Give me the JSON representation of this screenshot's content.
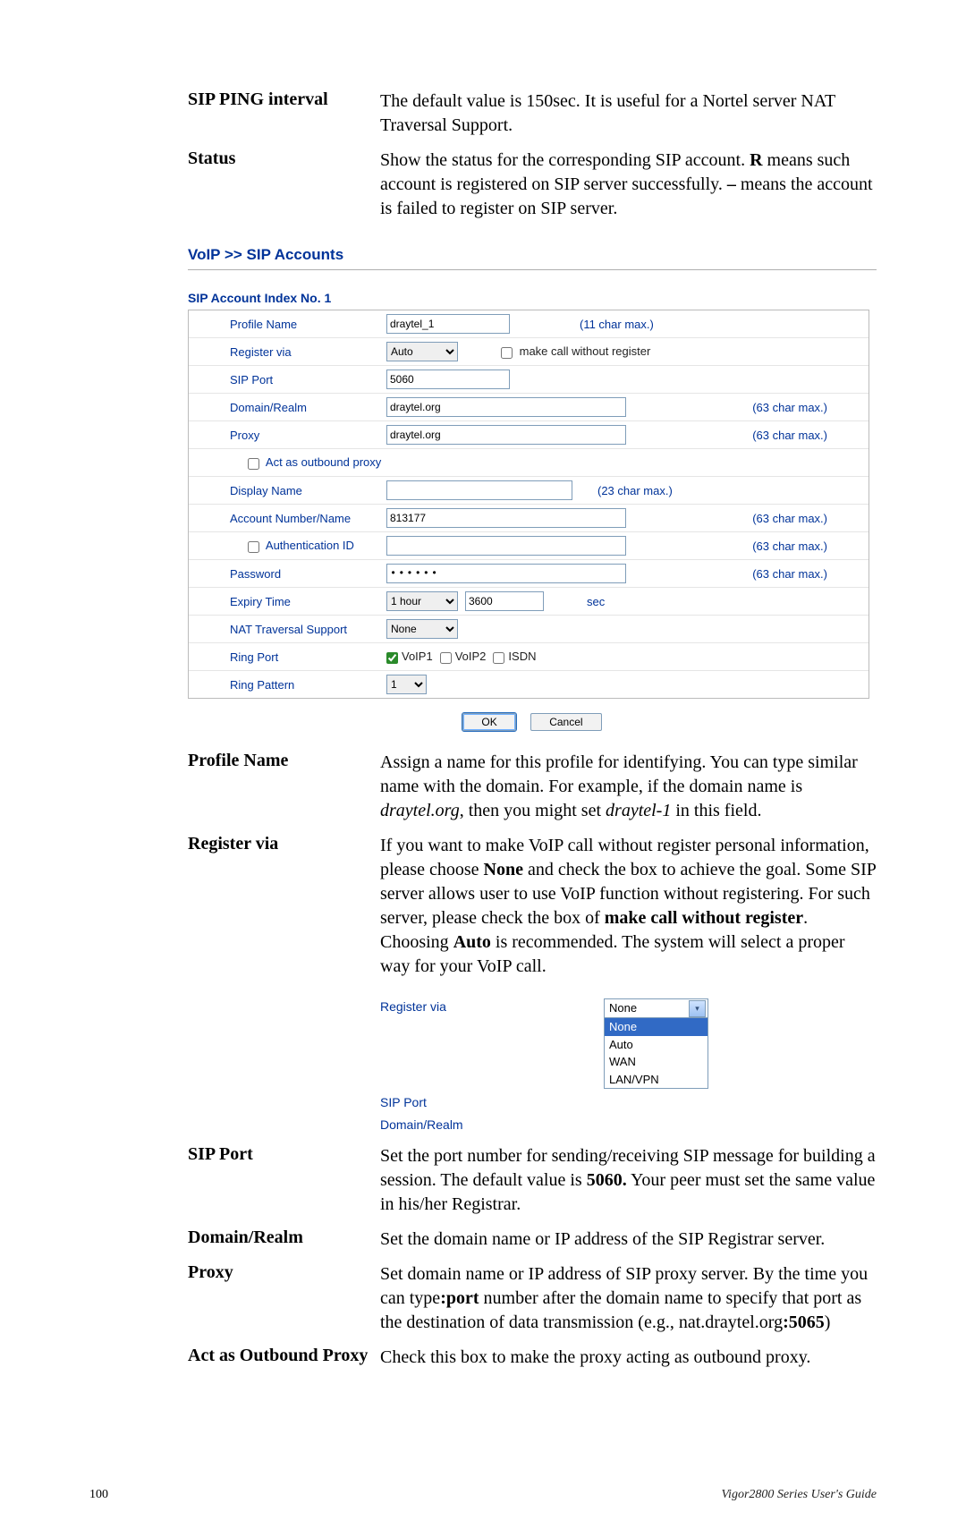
{
  "defs_top": [
    {
      "term": "SIP PING interval",
      "desc_html": "The default value is 150sec. It is useful for a Nortel server NAT Traversal Support."
    },
    {
      "term": "Status",
      "desc_html": "Show the status for the corresponding SIP account. <span class=\"b\">R</span> means such account is registered on SIP server successfully. <span class=\"b\">–</span> means the account is failed to register on SIP server."
    }
  ],
  "section_header": "VoIP >> SIP Accounts",
  "panel_title": "SIP Account Index No. 1",
  "form": {
    "profile_name": {
      "label": "Profile Name",
      "value": "draytel_1",
      "hint": "(11 char max.)"
    },
    "register_via": {
      "label": "Register via",
      "value": "Auto",
      "checkbox_label": "make call without register"
    },
    "sip_port": {
      "label": "SIP Port",
      "value": "5060"
    },
    "domain_realm": {
      "label": "Domain/Realm",
      "value": "draytel.org",
      "hint": "(63 char max.)"
    },
    "proxy": {
      "label": "Proxy",
      "value": "draytel.org",
      "hint": "(63 char max.)"
    },
    "outbound": {
      "label": "Act as outbound proxy"
    },
    "display_name": {
      "label": "Display Name",
      "value": "",
      "hint": "(23 char max.)"
    },
    "account": {
      "label": "Account Number/Name",
      "value": "813177",
      "hint": "(63 char max.)"
    },
    "auth_id": {
      "label": "Authentication ID",
      "value": "",
      "hint": "(63 char max.)"
    },
    "password": {
      "label": "Password",
      "value": "••••••",
      "hint": "(63 char max.)"
    },
    "expiry": {
      "label": "Expiry Time",
      "select": "1 hour",
      "value": "3600",
      "unit": "sec"
    },
    "nat": {
      "label": "NAT Traversal Support",
      "value": "None"
    },
    "ring_port": {
      "label": "Ring Port",
      "voip1": "VoIP1",
      "voip2": "VoIP2",
      "isdn": "ISDN"
    },
    "ring_pattern": {
      "label": "Ring Pattern",
      "value": "1"
    }
  },
  "buttons": {
    "ok": "OK",
    "cancel": "Cancel"
  },
  "defs_bottom": [
    {
      "term": "Profile Name",
      "desc_html": "Assign a name for this profile for identifying. You can type similar name with the domain. For example, if the domain name is <span class=\"i\">draytel.org</span>, then you might set <span class=\"i\">draytel-1</span> in this field."
    },
    {
      "term": "Register via",
      "desc_html": "If you want to make VoIP call without register personal information, please choose <span class=\"b\">None</span> and check the box to achieve the goal. Some SIP server allows user to use VoIP function without registering. For such server, please check the box of <span class=\"b\">make call without register</span>. Choosing <span class=\"b\">Auto</span> is recommended. The system will select a proper way for your VoIP call."
    },
    {
      "term": "SIP Port",
      "desc_html": "Set the port number for sending/receiving SIP message for building a session. The default value is <span class=\"b\">5060.</span> Your peer must set the same value in his/her Registrar."
    },
    {
      "term": "Domain/Realm",
      "desc_html": "Set the domain name or IP address of the SIP Registrar server."
    },
    {
      "term": "Proxy",
      "desc_html": "Set domain name or IP address of SIP proxy server. By the time you can type<span class=\"b\">:port</span> number after the domain name to specify that port as the destination of data transmission (e.g., nat.draytel.org<span class=\"b\">:5065</span>)"
    },
    {
      "term": "Act as Outbound Proxy",
      "desc_html": "Check this box to make the proxy acting as outbound proxy."
    }
  ],
  "snip": {
    "labels": {
      "register": "Register via",
      "sip_port": "SIP Port",
      "domain": "Domain/Realm"
    },
    "dd_top": "None",
    "dd_items": [
      "None",
      "Auto",
      "WAN",
      "LAN/VPN"
    ],
    "dd_selected_index": 0
  },
  "footer": {
    "page": "100",
    "guide": "Vigor2800  Series  User's Guide"
  }
}
